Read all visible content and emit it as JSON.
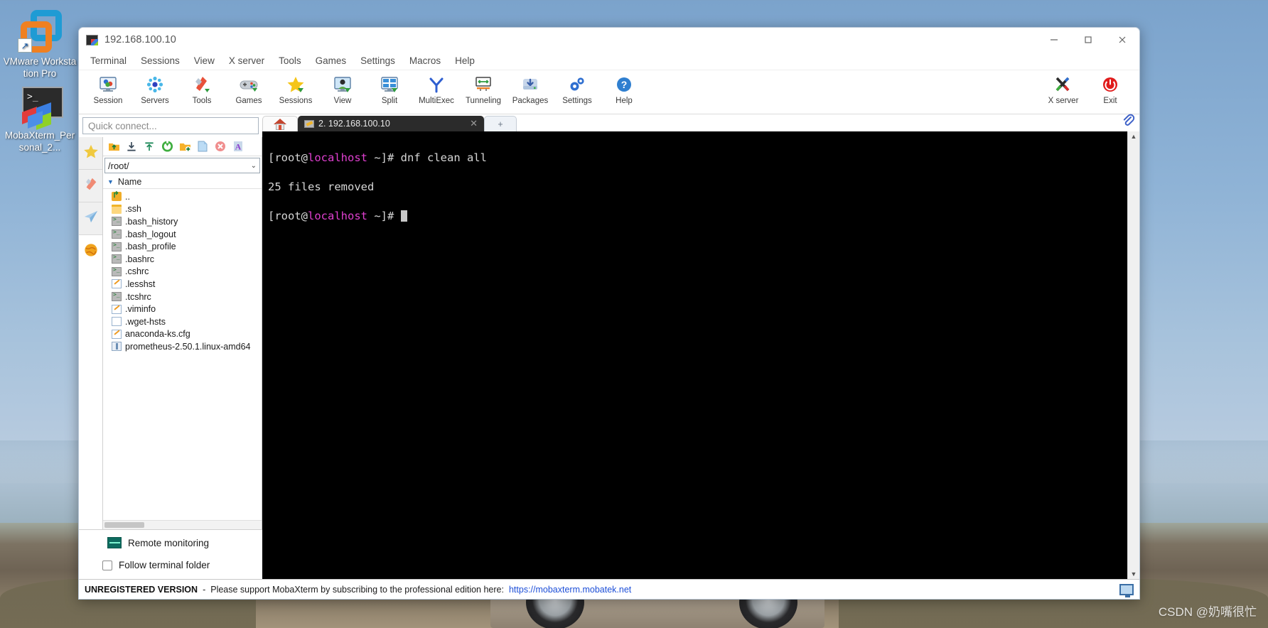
{
  "desktop": {
    "icons": [
      {
        "name": "vmware-workstation-pro",
        "label": "VMware Workstation Pro"
      },
      {
        "name": "mobaxterm-personal",
        "label": "MobaXterm_Personal_2..."
      }
    ]
  },
  "window": {
    "title": "192.168.100.10",
    "controls": {
      "minimize": "Minimize",
      "maximize": "Maximize",
      "close": "Close"
    }
  },
  "menubar": {
    "items": [
      {
        "label": "Terminal"
      },
      {
        "label": "Sessions"
      },
      {
        "label": "View"
      },
      {
        "label": "X server"
      },
      {
        "label": "Tools"
      },
      {
        "label": "Games"
      },
      {
        "label": "Settings"
      },
      {
        "label": "Macros"
      },
      {
        "label": "Help"
      }
    ]
  },
  "ribbon": {
    "items": [
      {
        "label": "Session",
        "icon": "session-icon"
      },
      {
        "label": "Servers",
        "icon": "servers-icon"
      },
      {
        "label": "Tools",
        "icon": "tools-icon"
      },
      {
        "label": "Games",
        "icon": "games-icon"
      },
      {
        "label": "Sessions",
        "icon": "sessions-star-icon"
      },
      {
        "label": "View",
        "icon": "view-icon"
      },
      {
        "label": "Split",
        "icon": "split-icon"
      },
      {
        "label": "MultiExec",
        "icon": "multiexec-icon"
      },
      {
        "label": "Tunneling",
        "icon": "tunneling-icon"
      },
      {
        "label": "Packages",
        "icon": "packages-icon"
      },
      {
        "label": "Settings",
        "icon": "settings-gear-icon"
      },
      {
        "label": "Help",
        "icon": "help-icon"
      }
    ],
    "right_items": [
      {
        "label": "X server",
        "icon": "x-server-icon"
      },
      {
        "label": "Exit",
        "icon": "exit-power-icon"
      }
    ]
  },
  "sidebar": {
    "quick_connect_placeholder": "Quick connect...",
    "vertical_tabs": [
      {
        "name": "sessions-tab",
        "icon": "star-icon"
      },
      {
        "name": "tools-tab",
        "icon": "swiss-knife-icon"
      },
      {
        "name": "sftp-tab",
        "icon": "paper-plane-icon"
      },
      {
        "name": "globe-tab",
        "icon": "globe-icon"
      }
    ],
    "file_tools": [
      {
        "name": "parent-folder-button",
        "icon": "folder-up-icon"
      },
      {
        "name": "download-button",
        "icon": "download-icon"
      },
      {
        "name": "upload-button",
        "icon": "upload-icon"
      },
      {
        "name": "refresh-button",
        "icon": "refresh-icon"
      },
      {
        "name": "new-folder-button",
        "icon": "new-folder-icon"
      },
      {
        "name": "new-file-button",
        "icon": "new-file-icon"
      },
      {
        "name": "delete-button",
        "icon": "delete-icon"
      },
      {
        "name": "text-mode-button",
        "icon": "font-icon"
      }
    ],
    "path": "/root/",
    "column_header": "Name",
    "files": [
      {
        "name": "..",
        "type": "folder-up"
      },
      {
        "name": ".ssh",
        "type": "folder"
      },
      {
        "name": ".bash_history",
        "type": "shell"
      },
      {
        "name": ".bash_logout",
        "type": "shell"
      },
      {
        "name": ".bash_profile",
        "type": "shell"
      },
      {
        "name": ".bashrc",
        "type": "shell"
      },
      {
        "name": ".cshrc",
        "type": "shell"
      },
      {
        "name": ".lesshst",
        "type": "doc"
      },
      {
        "name": ".tcshrc",
        "type": "shell"
      },
      {
        "name": ".viminfo",
        "type": "doc"
      },
      {
        "name": ".wget-hsts",
        "type": "plain"
      },
      {
        "name": "anaconda-ks.cfg",
        "type": "doc"
      },
      {
        "name": "prometheus-2.50.1.linux-amd64",
        "type": "archive"
      }
    ],
    "remote_monitoring_label": "Remote monitoring",
    "follow_terminal_folder_label": "Follow terminal folder"
  },
  "tabs": {
    "home_tab": "home-tab",
    "active_tab_label": "2. 192.168.100.10",
    "add_tab_label": "+",
    "attach_icon": "paperclip-icon"
  },
  "terminal": {
    "lines": [
      {
        "parts": [
          {
            "text": "[root@",
            "cls": "t-user"
          },
          {
            "text": "localhost",
            "cls": "t-host"
          },
          {
            "text": " ~]# dnf clean all",
            "cls": "t-user"
          }
        ]
      },
      {
        "parts": [
          {
            "text": "25 files removed",
            "cls": "t-user"
          }
        ]
      },
      {
        "parts": [
          {
            "text": "[root@",
            "cls": "t-user"
          },
          {
            "text": "localhost",
            "cls": "t-host"
          },
          {
            "text": " ~]# ",
            "cls": "t-user"
          }
        ],
        "cursor": true
      }
    ],
    "command": "dnf clean all",
    "output": "25 files removed",
    "prompt": "[root@localhost ~]#"
  },
  "footer": {
    "unregistered": "UNREGISTERED VERSION",
    "separator": "-",
    "message": "Please support MobaXterm by subscribing to the professional edition here:",
    "link": "https://mobaxterm.mobatek.net"
  },
  "watermark": "CSDN @奶嘴很忙",
  "colors": {
    "accent": "#1d4fd8",
    "terminal_bg": "#000000",
    "terminal_fg": "#d6d6d6",
    "host_color": "#e040d0",
    "tab_active_bg": "#2b2b2b"
  }
}
